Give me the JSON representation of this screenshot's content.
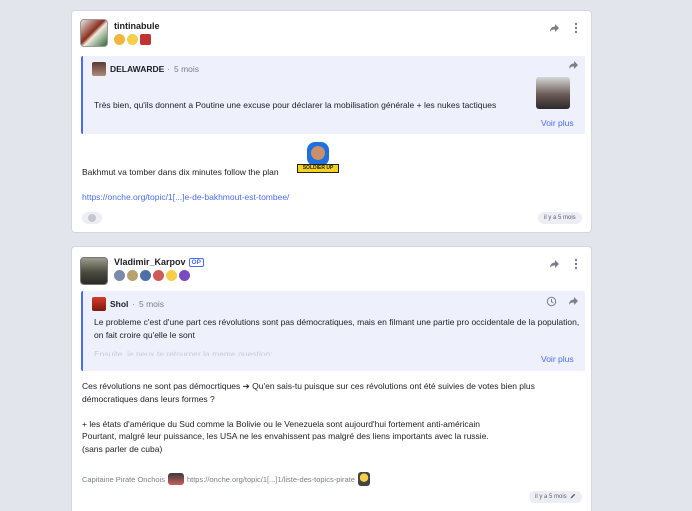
{
  "posts": [
    {
      "author": "tintinabule",
      "quote": {
        "author": "DELAWARDE",
        "time": "5 mois",
        "text": "Très bien, qu'ils donnent a Poutine une excuse pour déclarer la mobilisation générale + les nukes tactiques",
        "more_label": "Voir plus"
      },
      "body": "Bakhmut va tomber dans dix minutes follow the plan",
      "sticker_caption": "SOLDIER UP",
      "link": "https://onche.org/topic/1[...]e-de-bakhmout-est-tombee/",
      "time": "il y a 5 mois"
    },
    {
      "author": "Vladimir_Karpov",
      "op_badge": "OP",
      "quote": {
        "author": "Shol",
        "time": "5 mois",
        "text": "Le probleme c'est d'une part ces révolutions sont pas démocratiques, mais en filmant une partie pro occidentale de la population, on fait croire qu'elle le sont",
        "faded": "Ensuite, je peux te retourner la meme question:",
        "more_label": "Voir plus"
      },
      "body": "Ces révolutions ne sont pas démocrtiques ➔ Qu'en sais-tu puisque sur ces révolutions ont été suivies de votes bien plus démocratiques dans leurs formes ?\n\n+ les états d'amérique du Sud comme la Bolivie ou le Venezuela sont aujourd'hui fortement anti-américain\nPourtant, malgré leur puissance, les USA ne les envahissent pas malgré des liens importants avec la russie.\n(sans parler de cuba)",
      "signature_label": "Capitaine Pirate Onchois",
      "signature_link": "https://onche.org/topic/1[...]1/liste-des-topics-pirate",
      "time": "il y a 5 mois"
    }
  ],
  "colors": {
    "accent": "#4a6cf0",
    "background": "#e3e5ec",
    "card": "#ffffff",
    "quote_bg": "#eef0fb"
  },
  "icons": [
    "share-icon",
    "more-vertical-icon",
    "history-icon",
    "edit-icon",
    "reaction-icon"
  ]
}
